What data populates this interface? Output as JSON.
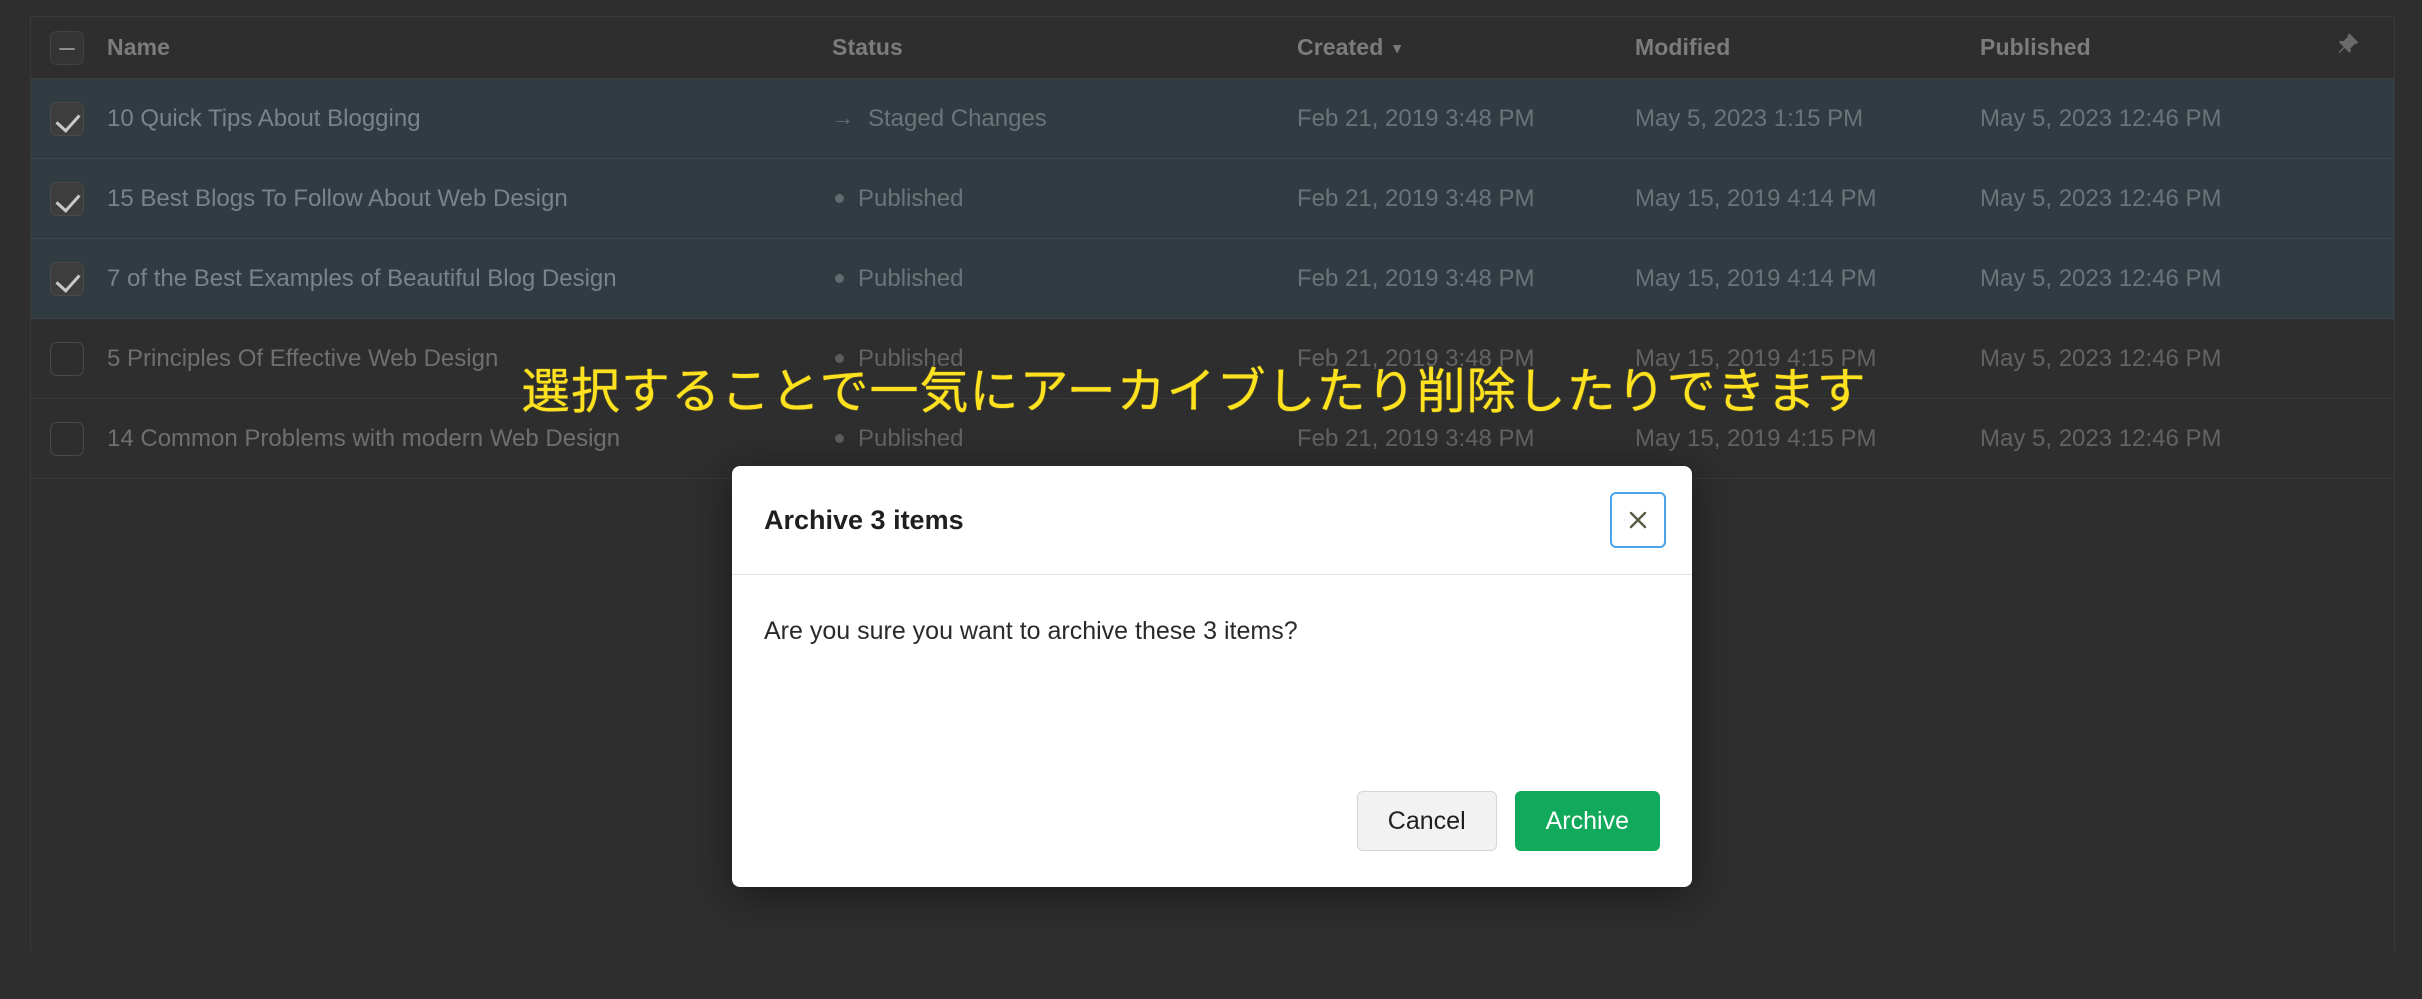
{
  "table": {
    "columns": [
      {
        "key": "name",
        "label": "Name"
      },
      {
        "key": "status",
        "label": "Status"
      },
      {
        "key": "created",
        "label": "Created",
        "sorted": true,
        "sort_caret": "▾"
      },
      {
        "key": "modified",
        "label": "Modified"
      },
      {
        "key": "published",
        "label": "Published"
      }
    ],
    "pin_icon": "pin-icon",
    "master_checkbox_state": "indeterminate",
    "rows": [
      {
        "selected": true,
        "name": "10 Quick Tips About Blogging",
        "status": "Staged Changes",
        "status_icon": "arrow-right-icon",
        "created": "Feb 21, 2019 3:48 PM",
        "modified": "May 5, 2023 1:15 PM",
        "published": "May 5, 2023 12:46 PM"
      },
      {
        "selected": true,
        "name": "15 Best Blogs To Follow About Web Design",
        "status": "Published",
        "status_icon": "dot-icon",
        "created": "Feb 21, 2019 3:48 PM",
        "modified": "May 15, 2019 4:14 PM",
        "published": "May 5, 2023 12:46 PM"
      },
      {
        "selected": true,
        "name": "7 of the Best Examples of Beautiful Blog Design",
        "status": "Published",
        "status_icon": "dot-icon",
        "created": "Feb 21, 2019 3:48 PM",
        "modified": "May 15, 2019 4:14 PM",
        "published": "May 5, 2023 12:46 PM"
      },
      {
        "selected": false,
        "name": "5 Principles Of Effective Web Design",
        "status": "Published",
        "status_icon": "dot-icon",
        "created": "Feb 21, 2019 3:48 PM",
        "modified": "May 15, 2019 4:15 PM",
        "published": "May 5, 2023 12:46 PM"
      },
      {
        "selected": false,
        "name": "14 Common Problems with modern Web Design",
        "status": "Published",
        "status_icon": "dot-icon",
        "created": "Feb 21, 2019 3:48 PM",
        "modified": "May 15, 2019 4:15 PM",
        "published": "May 5, 2023 12:46 PM"
      }
    ]
  },
  "annotation": {
    "text": "選択することで一気にアーカイブしたり削除したりできます",
    "color": "#ffe21f"
  },
  "modal": {
    "title": "Archive 3 items",
    "message": "Are you sure you want to archive these 3 items?",
    "close_label": "×",
    "cancel_label": "Cancel",
    "archive_label": "Archive",
    "archive_color": "#11a95b",
    "close_focus_color": "#4ba3ec"
  }
}
